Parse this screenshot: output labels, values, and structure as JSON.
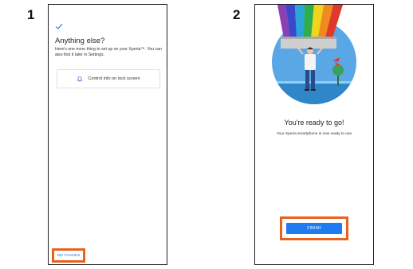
{
  "steps": [
    {
      "number": "1",
      "title": "Anything else?",
      "description": "Here's one more thing to set up on your Xperia™. You can also find it later in Settings.",
      "card_label": "Control info on lock screen",
      "card_icon": "bell-icon",
      "skip_button": "NO THANKS"
    },
    {
      "number": "2",
      "title": "You're ready to go!",
      "description": "Your Xperia smartphone is now ready to use",
      "finish_button": "FINISH"
    }
  ],
  "colors": {
    "accent_blue": "#1f7bf0",
    "link_blue": "#2a6fe0",
    "highlight_orange": "#e8621c",
    "sky": "#5aa7e6",
    "sea": "#2f86c9"
  }
}
